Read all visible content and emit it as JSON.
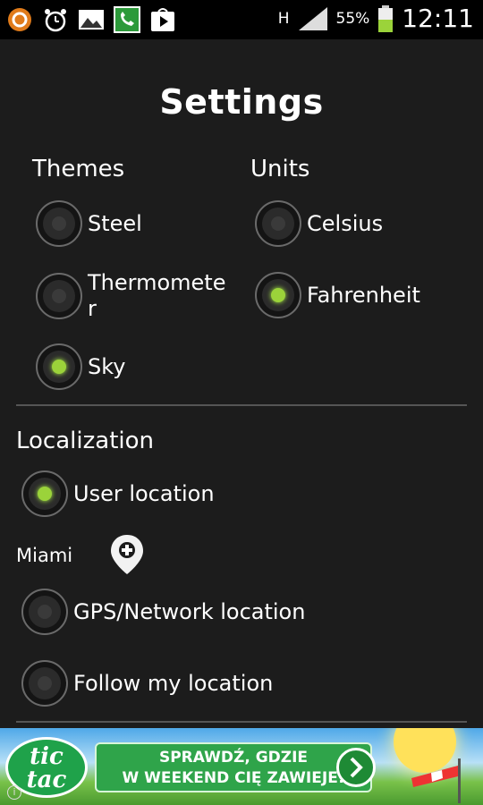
{
  "status_bar": {
    "battery_percent": "55%",
    "network": "H",
    "clock": "12:11",
    "icons": [
      "orange-circle-icon",
      "alarm-icon",
      "image-icon",
      "phone-icon",
      "play-store-icon"
    ]
  },
  "header": {
    "title": "Settings"
  },
  "themes": {
    "heading": "Themes",
    "options": [
      {
        "label": "Steel",
        "checked": false
      },
      {
        "label": "Thermomete\nr",
        "checked": false
      },
      {
        "label": "Sky",
        "checked": true
      }
    ]
  },
  "units": {
    "heading": "Units",
    "options": [
      {
        "label": "Celsius",
        "checked": false
      },
      {
        "label": "Fahrenheit",
        "checked": true
      }
    ]
  },
  "localization": {
    "heading": "Localization",
    "options": [
      {
        "label": "User location",
        "checked": true
      },
      {
        "label": "GPS/Network location",
        "checked": false
      },
      {
        "label": "Follow my location",
        "checked": false
      }
    ],
    "city": "Miami"
  },
  "ad": {
    "brand_line1": "tic",
    "brand_line2": "tac",
    "line1": "SPRAWDŹ, GDZIE",
    "line2": "W WEEKEND CIĘ ZAWIEJE!",
    "info": "i"
  },
  "colors": {
    "accent": "#9bd33a",
    "background": "#1c1c1c",
    "divider": "#555555"
  }
}
